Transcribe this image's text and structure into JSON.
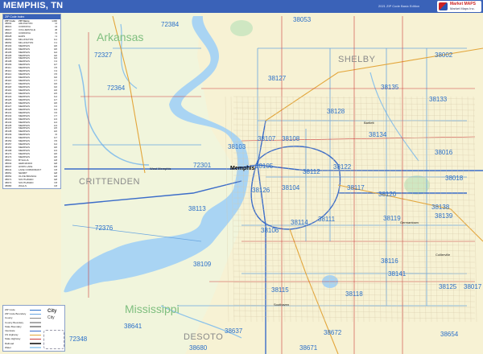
{
  "header": {
    "title": "MEMPHIS, TN",
    "edition": "2021 ZIP Code Basic Edition",
    "logo_line1": "Market MAPS",
    "logo_line2": "Market Maps Inc."
  },
  "index": {
    "heading": "ZIP Code Index",
    "columns": [
      "ZIP Code",
      "ZIP Name",
      "LOC"
    ],
    "rows": [
      [
        "38002",
        "ARLINGTON",
        "I2"
      ],
      [
        "38016",
        "CORDOVA",
        "J4"
      ],
      [
        "38017",
        "COLLIERVILLE",
        "J8"
      ],
      [
        "38018",
        "CORDOVA",
        "I5"
      ],
      [
        "38028",
        "EADS",
        "I1"
      ],
      [
        "38053",
        "MILLINGTON",
        "G1"
      ],
      [
        "38054",
        "MILLINGTON",
        "F1"
      ],
      [
        "38103",
        "MEMPHIS",
        "E5"
      ],
      [
        "38104",
        "MEMPHIS",
        "E5"
      ],
      [
        "38105",
        "MEMPHIS",
        "E4"
      ],
      [
        "38106",
        "MEMPHIS",
        "E6"
      ],
      [
        "38107",
        "MEMPHIS",
        "E4"
      ],
      [
        "38108",
        "MEMPHIS",
        "F4"
      ],
      [
        "38109",
        "MEMPHIS",
        "E7"
      ],
      [
        "38111",
        "MEMPHIS",
        "F5"
      ],
      [
        "38112",
        "MEMPHIS",
        "F4"
      ],
      [
        "38114",
        "MEMPHIS",
        "F5"
      ],
      [
        "38115",
        "MEMPHIS",
        "G6"
      ],
      [
        "38116",
        "MEMPHIS",
        "F7"
      ],
      [
        "38117",
        "MEMPHIS",
        "G5"
      ],
      [
        "38118",
        "MEMPHIS",
        "G6"
      ],
      [
        "38119",
        "MEMPHIS",
        "H6"
      ],
      [
        "38120",
        "MEMPHIS",
        "H5"
      ],
      [
        "38122",
        "MEMPHIS",
        "G4"
      ],
      [
        "38125",
        "MEMPHIS",
        "H7"
      ],
      [
        "38126",
        "MEMPHIS",
        "E5"
      ],
      [
        "38127",
        "MEMPHIS",
        "F2"
      ],
      [
        "38128",
        "MEMPHIS",
        "G3"
      ],
      [
        "38131",
        "MEMPHIS",
        "F6"
      ],
      [
        "38132",
        "MEMPHIS",
        "F7"
      ],
      [
        "38133",
        "MEMPHIS",
        "H3"
      ],
      [
        "38134",
        "MEMPHIS",
        "H4"
      ],
      [
        "38135",
        "MEMPHIS",
        "H3"
      ],
      [
        "38137",
        "MEMPHIS",
        "H5"
      ],
      [
        "38138",
        "MEMPHIS",
        "H6"
      ],
      [
        "38139",
        "MEMPHIS",
        "I6"
      ],
      [
        "38141",
        "MEMPHIS",
        "G7"
      ],
      [
        "38152",
        "MEMPHIS",
        "F5"
      ],
      [
        "38157",
        "MEMPHIS",
        "G4"
      ],
      [
        "38163",
        "MEMPHIS",
        "E5"
      ],
      [
        "38168",
        "MEMPHIS",
        "H3"
      ],
      [
        "38173",
        "MEMPHIS",
        "E5"
      ],
      [
        "38174",
        "MEMPHIS",
        "E5"
      ],
      [
        "38611",
        "BYHALIA",
        "H8"
      ],
      [
        "38632",
        "HERNANDO",
        "E8"
      ],
      [
        "38637",
        "HORN LAKE",
        "D8"
      ],
      [
        "38641",
        "LAKE CORMORANT",
        "C8"
      ],
      [
        "38651",
        "NESBIT",
        "E8"
      ],
      [
        "38654",
        "OLIVE BRANCH",
        "G8"
      ],
      [
        "38671",
        "SOUTHAVEN",
        "E8"
      ],
      [
        "38672",
        "SOUTHAVEN",
        "F8"
      ],
      [
        "38680",
        "WALLS",
        "C8"
      ],
      [
        "72301",
        "WEST MEMPHIS",
        "C5"
      ],
      [
        "72327",
        "CRAWFORDSVILLE",
        "A2"
      ],
      [
        "72339",
        "HUGHES",
        "A8"
      ],
      [
        "72364",
        "MARION",
        "B3"
      ],
      [
        "72376",
        "PROCTOR",
        "B6"
      ],
      [
        "72384",
        "TURRELL",
        "B1"
      ]
    ]
  },
  "legend": {
    "city_label": "City",
    "city_label2": "City",
    "rows": [
      "ZIP Code",
      "ZIP Code Boundary",
      "County",
      "County Boundary",
      "State Boundary",
      "Interstate",
      "US Highway",
      "State Highway",
      "Railroad",
      "Water"
    ]
  },
  "map": {
    "states": [
      "Arkansas",
      "Mississippi"
    ],
    "counties": [
      "SHELBY",
      "CRITTENDEN",
      "DESOTO"
    ],
    "city": "Memphis",
    "small_places": [
      "West Memphis",
      "Germantown",
      "Collierville",
      "Southaven",
      "Bartlett"
    ],
    "zip_labels": [
      "38053",
      "72384",
      "38002",
      "72327",
      "38127",
      "72364",
      "38135",
      "38133",
      "38128",
      "38134",
      "38103",
      "38107",
      "38108",
      "38016",
      "72301",
      "38105",
      "38112",
      "38122",
      "38018",
      "38126",
      "38104",
      "38117",
      "38120",
      "38113",
      "38111",
      "38138",
      "38114",
      "38119",
      "38139",
      "72376",
      "38106",
      "38116",
      "38115",
      "38109",
      "38141",
      "38125",
      "38017",
      "38118",
      "38641",
      "38637",
      "38672",
      "38654",
      "72348",
      "38680",
      "38671"
    ],
    "colors": {
      "land_tn": "#fbf6d8",
      "land_ar": "#f3f9e3",
      "river": "#aed5f2",
      "road": "#c33",
      "highway": "#e3b13e",
      "zip": "#2a6fc9"
    }
  }
}
